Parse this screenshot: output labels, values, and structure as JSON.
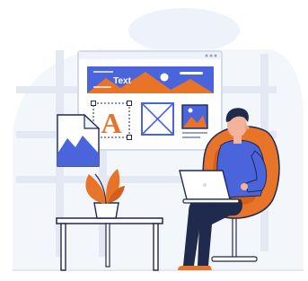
{
  "illustration": {
    "subject": "web-designer-at-work",
    "banner_text": "Text",
    "type_sample_letter": "A"
  },
  "colors": {
    "primary_blue": "#4A64DB",
    "accent_orange": "#E8742A",
    "navy": "#1F2A4D",
    "skin": "#F2B39A",
    "blob_light": "#EEF2FA",
    "window_border": "#D4DBEA"
  }
}
